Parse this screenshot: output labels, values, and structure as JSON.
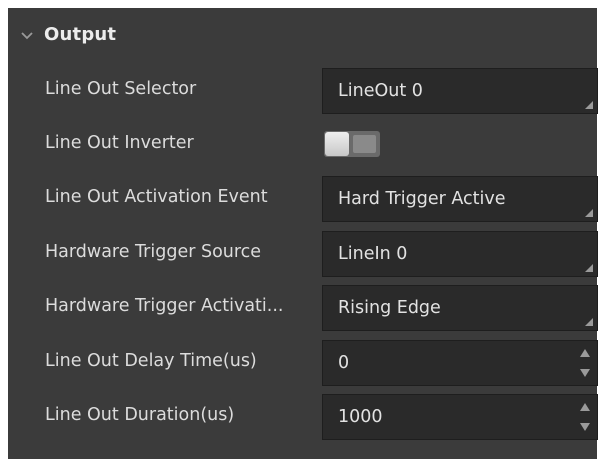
{
  "section": {
    "title": "Output",
    "chevron_icon": "chevron-down-icon"
  },
  "fields": {
    "line_out_selector": {
      "label": "Line Out Selector",
      "value": "LineOut 0"
    },
    "line_out_inverter": {
      "label": "Line Out Inverter",
      "enabled": false
    },
    "line_out_activation_event": {
      "label": "Line Out Activation Event",
      "value": "Hard Trigger Active"
    },
    "hardware_trigger_source": {
      "label": "Hardware Trigger Source",
      "value": "LineIn 0"
    },
    "hardware_trigger_activation": {
      "label": "Hardware Trigger Activati...",
      "value": "Rising Edge"
    },
    "line_out_delay_time": {
      "label": "Line Out Delay Time(us)",
      "value": "0"
    },
    "line_out_duration": {
      "label": "Line Out Duration(us)",
      "value": "1000"
    }
  },
  "colors": {
    "panel_bg": "#3b3b3b",
    "field_bg": "#2a2a2a",
    "text": "#dcdcdc"
  }
}
